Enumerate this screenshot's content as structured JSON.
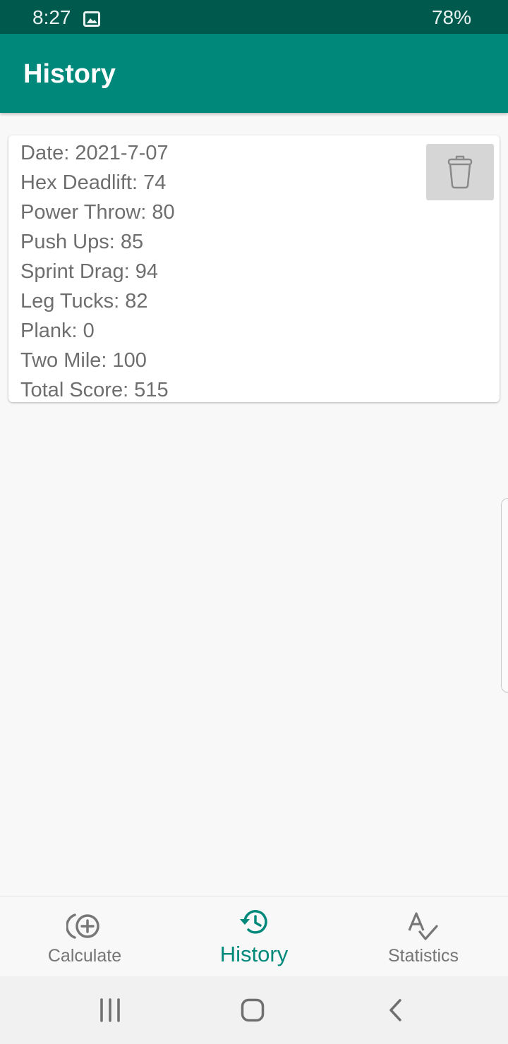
{
  "status_bar": {
    "time": "8:27",
    "battery": "78%",
    "image_icon": "image-icon"
  },
  "app_bar": {
    "title": "History"
  },
  "history": {
    "entries": [
      {
        "lines": [
          "Date: 2021-7-07",
          "Hex Deadlift: 74",
          "Power Throw: 80",
          "Push Ups: 85",
          "Sprint Drag: 94",
          "Leg Tucks: 82",
          "Plank: 0",
          "Two Mile: 100",
          "Total Score: 515"
        ],
        "delete_icon": "trash-icon"
      }
    ]
  },
  "bottom_nav": {
    "items": [
      {
        "label": "Calculate",
        "icon": "calculate-icon",
        "active": false
      },
      {
        "label": "History",
        "icon": "history-icon",
        "active": true
      },
      {
        "label": "Statistics",
        "icon": "statistics-icon",
        "active": false
      }
    ]
  },
  "system_nav": {
    "buttons": [
      "recents-icon",
      "home-icon",
      "back-icon"
    ]
  },
  "colors": {
    "primary": "#00897b",
    "status_bar": "#00594d",
    "card_text": "#6e6e6e",
    "nav_inactive": "#757575"
  }
}
